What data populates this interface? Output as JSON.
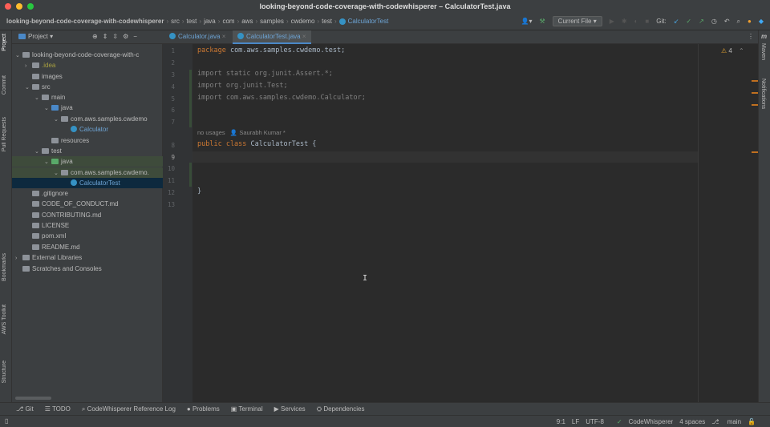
{
  "window": {
    "title": "looking-beyond-code-coverage-with-codewhisperer – CalculatorTest.java"
  },
  "breadcrumb": [
    "looking-beyond-code-coverage-with-codewhisperer",
    "src",
    "test",
    "java",
    "com",
    "aws",
    "samples",
    "cwdemo",
    "test",
    "CalculatorTest"
  ],
  "toolbar": {
    "run_config": "Current File",
    "git_label": "Git:"
  },
  "project_panel": {
    "title": "Project"
  },
  "tabs": [
    {
      "label": "Calculator.java"
    },
    {
      "label": "CalculatorTest.java"
    }
  ],
  "left_strip": [
    "Project",
    "Commit",
    "Pull Requests",
    "Bookmarks",
    "AWS Toolkit",
    "Structure"
  ],
  "right_strip": [
    "Maven",
    "Notifications"
  ],
  "tree": [
    {
      "label": "looking-beyond-code-coverage-with-c",
      "depth": 0,
      "arrow": "v"
    },
    {
      "label": ".idea",
      "depth": 1,
      "arrow": ">"
    },
    {
      "label": "images",
      "depth": 1,
      "arrow": ""
    },
    {
      "label": "src",
      "depth": 1,
      "arrow": "v"
    },
    {
      "label": "main",
      "depth": 2,
      "arrow": "v"
    },
    {
      "label": "java",
      "depth": 3,
      "arrow": "v"
    },
    {
      "label": "com.aws.samples.cwdemo",
      "depth": 4,
      "arrow": "v"
    },
    {
      "label": "Calculator",
      "depth": 5,
      "arrow": ""
    },
    {
      "label": "resources",
      "depth": 3,
      "arrow": ""
    },
    {
      "label": "test",
      "depth": 2,
      "arrow": "v"
    },
    {
      "label": "java",
      "depth": 3,
      "arrow": "v"
    },
    {
      "label": "com.aws.samples.cwdemo.",
      "depth": 4,
      "arrow": "v"
    },
    {
      "label": "CalculatorTest",
      "depth": 5,
      "arrow": ""
    },
    {
      "label": ".gitignore",
      "depth": 1,
      "arrow": ""
    },
    {
      "label": "CODE_OF_CONDUCT.md",
      "depth": 1,
      "arrow": ""
    },
    {
      "label": "CONTRIBUTING.md",
      "depth": 1,
      "arrow": ""
    },
    {
      "label": "LICENSE",
      "depth": 1,
      "arrow": ""
    },
    {
      "label": "pom.xml",
      "depth": 1,
      "arrow": ""
    },
    {
      "label": "README.md",
      "depth": 1,
      "arrow": ""
    },
    {
      "label": "External Libraries",
      "depth": 0,
      "arrow": ">"
    },
    {
      "label": "Scratches and Consoles",
      "depth": 0,
      "arrow": ""
    }
  ],
  "editor": {
    "line_numbers": [
      "1",
      "2",
      "3",
      "4",
      "5",
      "6",
      "7",
      "8",
      "9",
      "10",
      "11",
      "12",
      "13"
    ],
    "lines": {
      "l1_kw": "package",
      "l1": " com.aws.samples.cwdemo.test;",
      "l3": "import static org.junit.Assert.*;",
      "l4": "import org.junit.Test;",
      "l5": "import com.aws.samples.cwdemo.Calculator;",
      "hint_usages": "no usages",
      "hint_author": "Saurabh Kumar *",
      "l8_kw": "public class",
      "l8": " CalculatorTest {",
      "l12": "}"
    },
    "warnings": "4"
  },
  "bottom_tools": [
    "Git",
    "TODO",
    "CodeWhisperer Reference Log",
    "Problems",
    "Terminal",
    "Services",
    "Dependencies"
  ],
  "status": {
    "position": "9:1",
    "line_sep": "LF",
    "encoding": "UTF-8",
    "codewhisperer": "CodeWhisperer",
    "indent": "4 spaces",
    "branch": "main"
  }
}
